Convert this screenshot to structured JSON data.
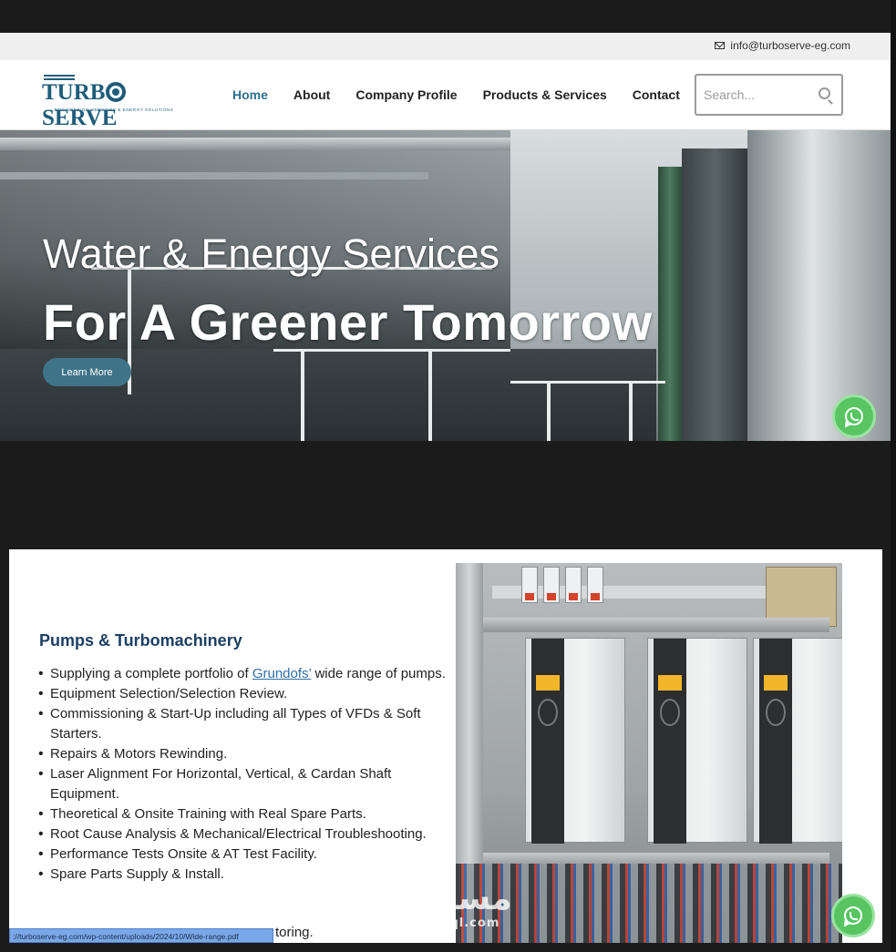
{
  "topbar": {
    "email": "info@turboserve-eg.com"
  },
  "logo": {
    "word_left": "TURB",
    "word_right": "SERVE",
    "tagline": "ENGINEERING SERVICES & ENERGY SOLUTIONS"
  },
  "nav": {
    "items": [
      {
        "label": "Home",
        "active": true
      },
      {
        "label": "About"
      },
      {
        "label": "Company Profile"
      },
      {
        "label": "Products & Services"
      },
      {
        "label": "Contact"
      }
    ]
  },
  "search": {
    "placeholder": "Search..."
  },
  "hero": {
    "title": "Water & Energy Services",
    "subtitle": "For A Greener Tomorrow",
    "button_label": "Learn More"
  },
  "section": {
    "title": "Pumps & Turbomachinery",
    "bullets": {
      "b0_before": "Supplying a complete portfolio of ",
      "b0_link": "Grundofs’",
      "b0_after": " wide range of pumps.",
      "b1": "Equipment Selection/Selection Review.",
      "b2": "Commissioning & Start-Up including all Types of VFDs & Soft Starters.",
      "b3": "Repairs & Motors Rewinding.",
      "b4": "Laser Alignment For Horizontal, Vertical, & Cardan Shaft Equipment.",
      "b5": "Theoretical & Onsite Training with Real Spare Parts.",
      "b6": "Root Cause Analysis & Mechanical/Electrical Troubleshooting.",
      "b7": "Performance Tests Onsite & AT Test Facility.",
      "b8": "Spare Parts Supply & Install."
    },
    "cut_text": "toring."
  },
  "status_url": "://turboserve-eg.com/wp-content/uploads/2024/10/Wide-range.pdf",
  "watermark": {
    "arabic": "مستقل",
    "latin": "mostaql.com"
  },
  "colors": {
    "accent": "#2f6f8f",
    "brand": "#1e5d7a",
    "whatsapp": "#58c562",
    "button": "#3f7488"
  }
}
